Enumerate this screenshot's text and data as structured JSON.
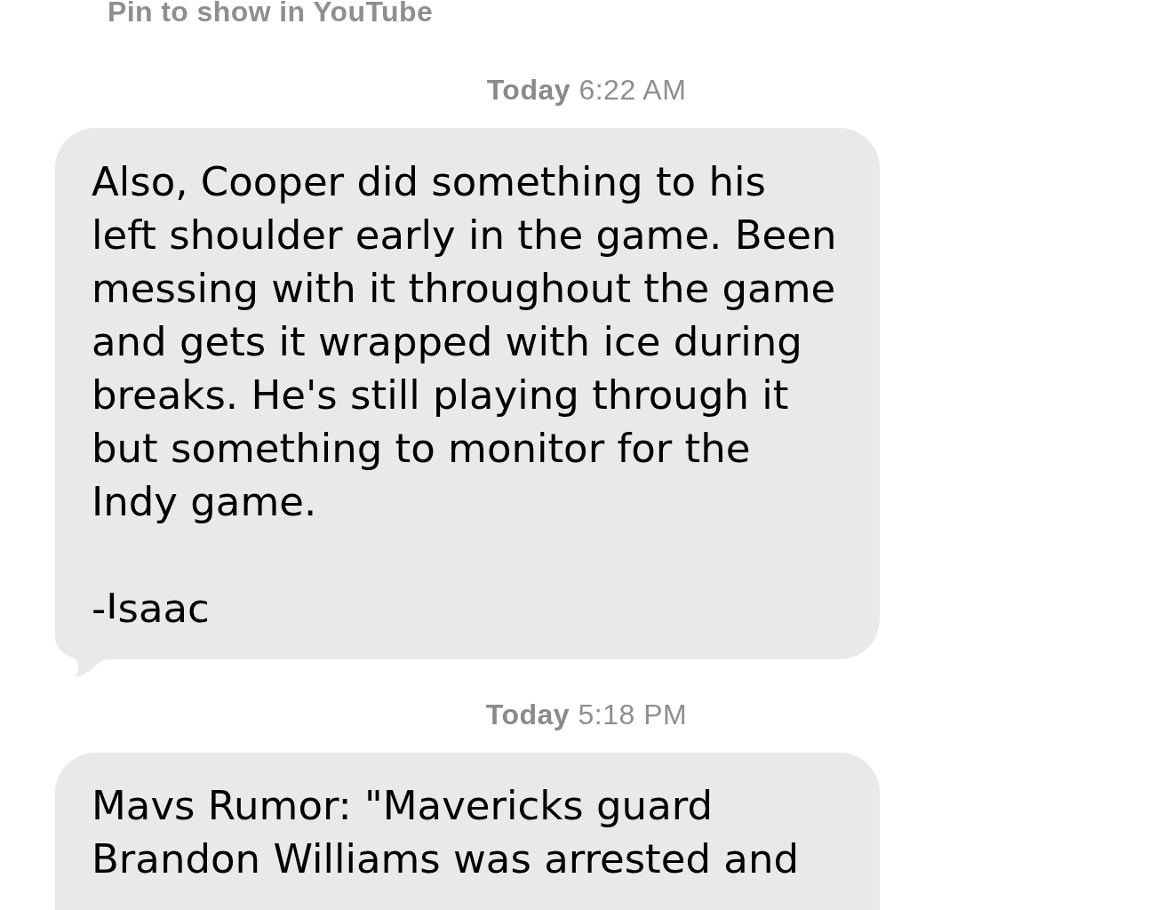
{
  "pinned_note": {
    "text": "Pin to show in YouTube"
  },
  "messages": [
    {
      "timestamp": "**Today** 6:22 AM",
      "paragraphs": [
        "Also, Cooper did something to his left shoulder early in the game. Been messing with it throughout the game and gets it wrapped with ice during breaks. He's still playing through it but something to monitor for the Indy game.",
        "-Isaac"
      ],
      "tail": true
    },
    {
      "timestamp": "**Today** 5:18 PM",
      "paragraphs": [
        "Mavs Rumor: \"Mavericks guard Brandon Williams was arrested and"
      ]
    }
  ]
}
